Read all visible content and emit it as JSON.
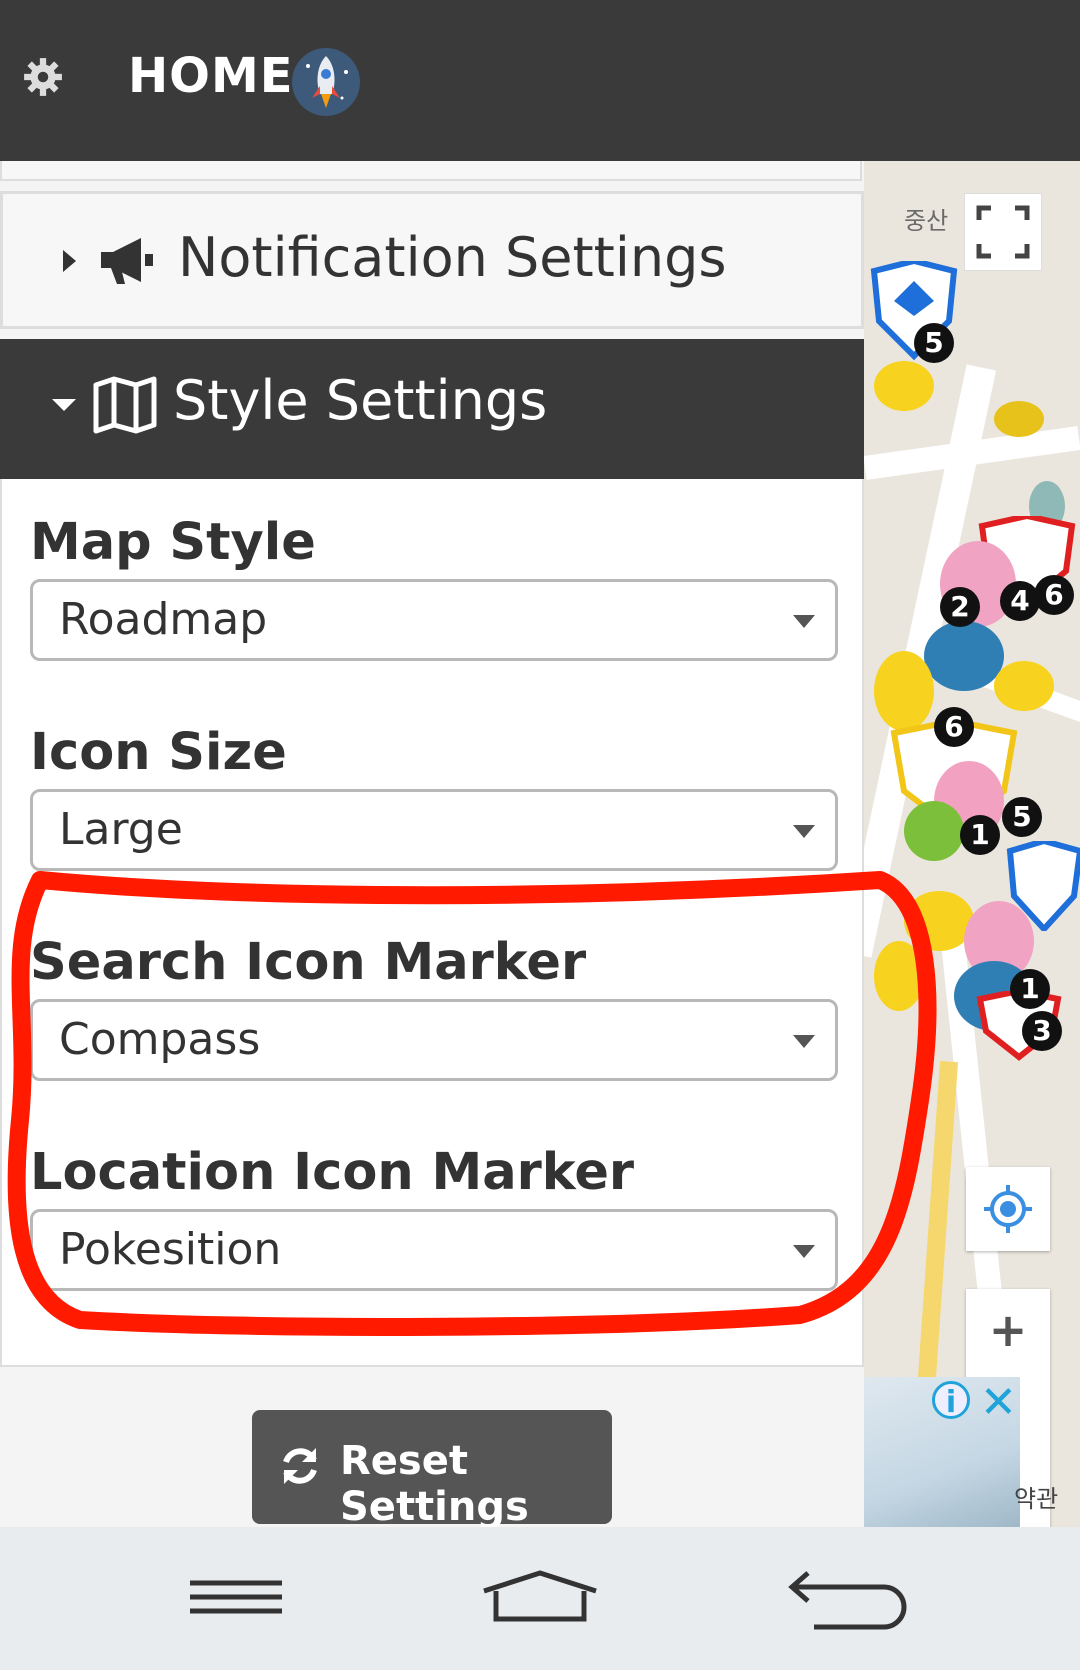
{
  "header": {
    "title": "HOME"
  },
  "panel": {
    "notification_label": "Notification Settings",
    "style_label": "Style Settings",
    "fields": [
      {
        "label": "Map Style",
        "value": "Roadmap"
      },
      {
        "label": "Icon Size",
        "value": "Large"
      },
      {
        "label": "Search Icon Marker",
        "value": "Compass"
      },
      {
        "label": "Location Icon Marker",
        "value": "Pokesition"
      }
    ],
    "reset_label": "Reset Settings"
  },
  "map": {
    "place_label": "중산",
    "bottom_label": "약관",
    "badges": [
      "5",
      "2",
      "4",
      "6",
      "6",
      "5",
      "1",
      "1",
      "3"
    ],
    "ad_info": "i",
    "ad_close": "✕"
  },
  "colors": {
    "header_bg": "#3a3a3a",
    "annotation": "#ff1a00",
    "accent_blue": "#1fa3d8"
  }
}
